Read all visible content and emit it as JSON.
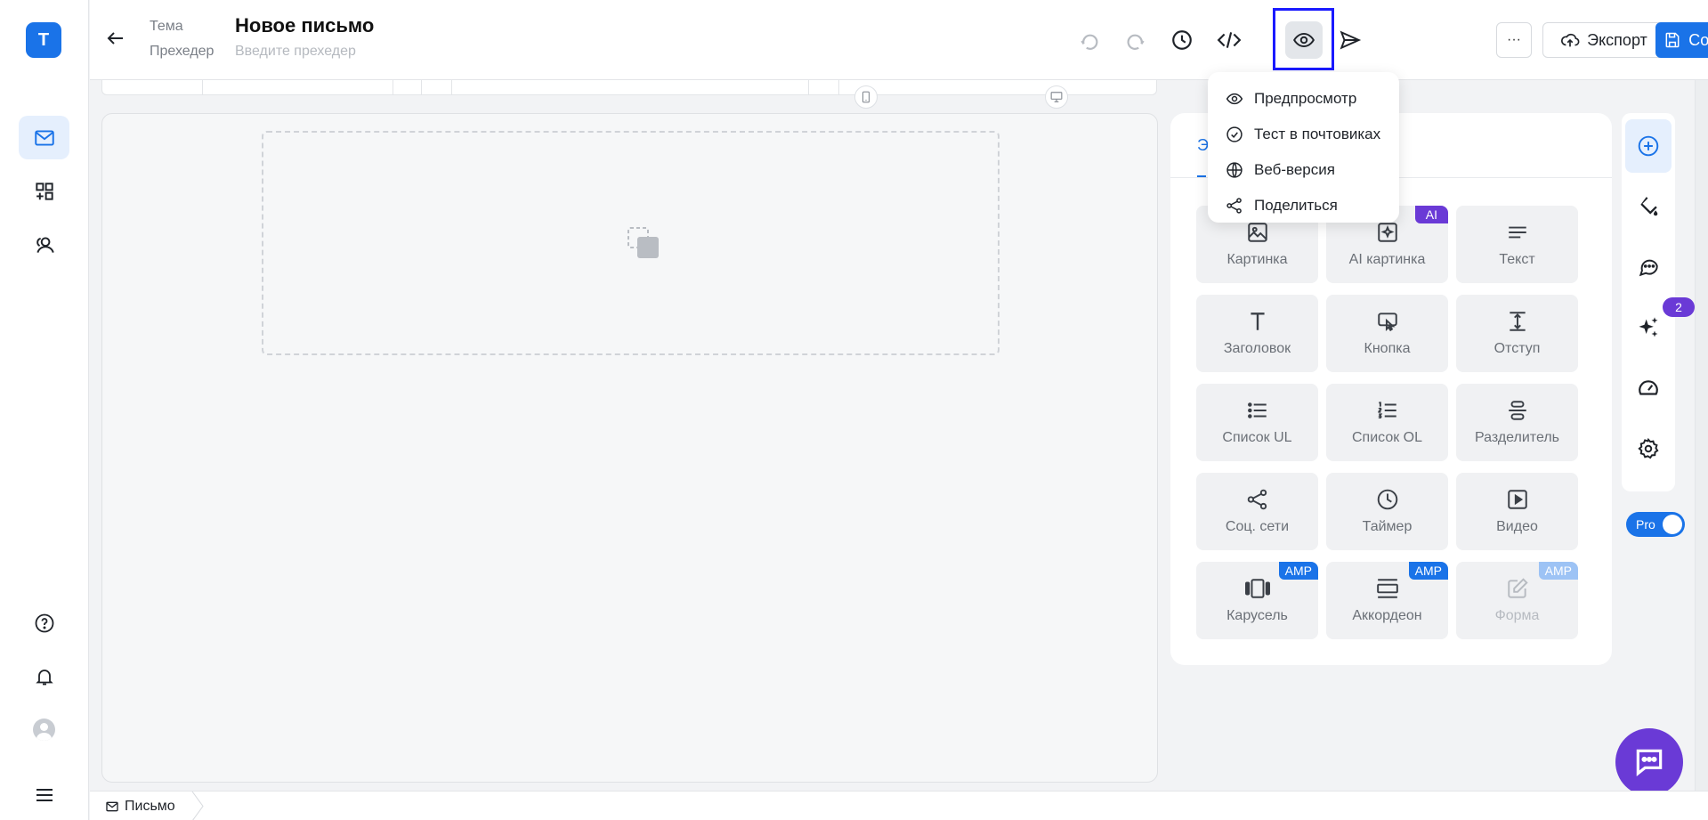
{
  "header": {
    "theme_label": "Тема",
    "preheader_label": "Прехедер",
    "title": "Новое письмо",
    "preheader_placeholder": "Введите прехедер",
    "more_label": "···",
    "export_label": "Экспорт",
    "save_label": "Сохранить"
  },
  "rail": {
    "logo_letter": "T"
  },
  "preview_menu": {
    "items": [
      {
        "label": "Предпросмотр",
        "icon": "eye-icon"
      },
      {
        "label": "Тест в почтовиках",
        "icon": "check-circle-icon"
      },
      {
        "label": "Веб-версия",
        "icon": "globe-icon"
      },
      {
        "label": "Поделиться",
        "icon": "share-icon"
      }
    ]
  },
  "panel": {
    "tab_label": "Э",
    "tiles": [
      {
        "label": "Картинка",
        "icon": "image-icon"
      },
      {
        "label": "AI картинка",
        "icon": "ai-image-icon",
        "tag": "AI"
      },
      {
        "label": "Текст",
        "icon": "text-lines-icon"
      },
      {
        "label": "Заголовок",
        "icon": "heading-icon"
      },
      {
        "label": "Кнопка",
        "icon": "button-icon"
      },
      {
        "label": "Отступ",
        "icon": "spacer-icon"
      },
      {
        "label": "Список UL",
        "icon": "list-ul-icon"
      },
      {
        "label": "Список OL",
        "icon": "list-ol-icon"
      },
      {
        "label": "Разделитель",
        "icon": "divider-icon"
      },
      {
        "label": "Соц. сети",
        "icon": "share-icon"
      },
      {
        "label": "Таймер",
        "icon": "clock-icon"
      },
      {
        "label": "Видео",
        "icon": "video-icon"
      },
      {
        "label": "Карусель",
        "icon": "carousel-icon",
        "tag": "AMP"
      },
      {
        "label": "Аккордеон",
        "icon": "accordion-icon",
        "tag": "AMP"
      },
      {
        "label": "Форма",
        "icon": "form-edit-icon",
        "tag": "AMP",
        "disabled": true
      }
    ]
  },
  "right_rail": {
    "badge_count": "2",
    "pro_label": "Pro"
  },
  "footer": {
    "breadcrumb": "Письмо"
  },
  "colors": {
    "accent": "#1a73e8",
    "purple": "#6a3ad6"
  }
}
